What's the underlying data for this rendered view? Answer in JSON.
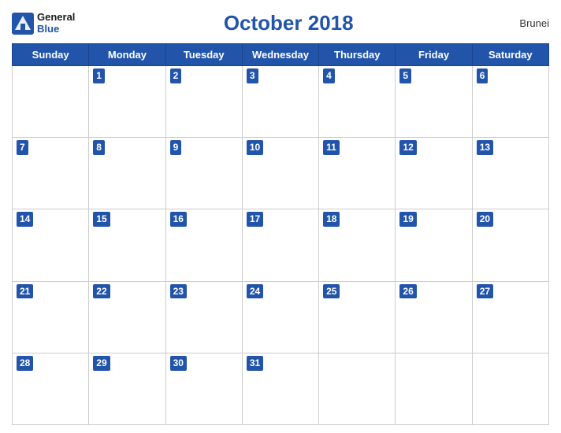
{
  "header": {
    "logo_general": "General",
    "logo_blue": "Blue",
    "title": "October 2018",
    "country": "Brunei"
  },
  "days_of_week": [
    "Sunday",
    "Monday",
    "Tuesday",
    "Wednesday",
    "Thursday",
    "Friday",
    "Saturday"
  ],
  "weeks": [
    [
      null,
      1,
      2,
      3,
      4,
      5,
      6
    ],
    [
      7,
      8,
      9,
      10,
      11,
      12,
      13
    ],
    [
      14,
      15,
      16,
      17,
      18,
      19,
      20
    ],
    [
      21,
      22,
      23,
      24,
      25,
      26,
      27
    ],
    [
      28,
      29,
      30,
      31,
      null,
      null,
      null
    ]
  ]
}
